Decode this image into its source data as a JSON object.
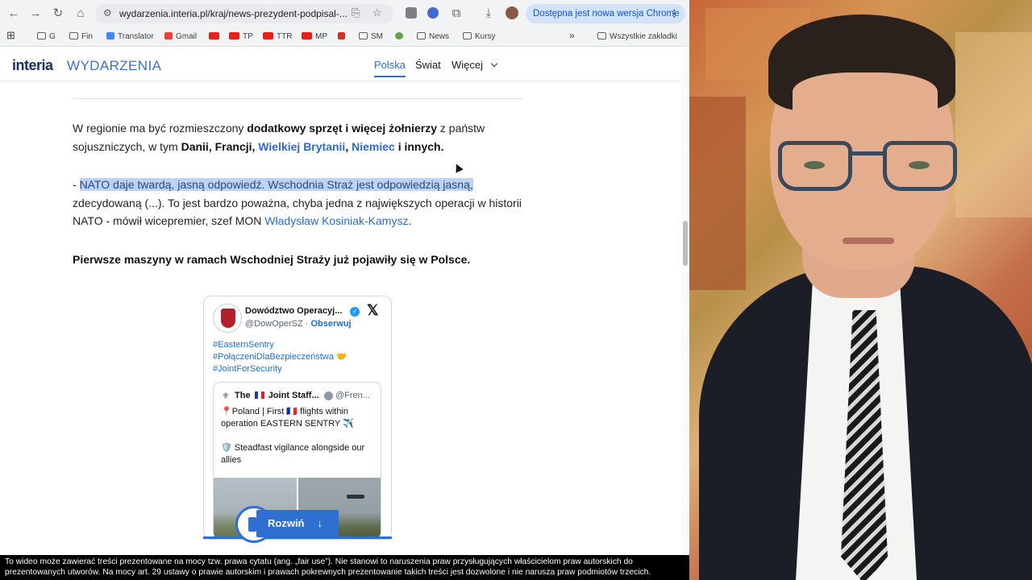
{
  "browser": {
    "url": "wydarzenia.interia.pl/kraj/news-prezydent-podpisal-...",
    "update_text": "Dostępna jest nowa wersja Chrome",
    "bookmarks": [
      "G",
      "Fin",
      "Translator",
      "Gmail",
      "TP",
      "TTR",
      "MP",
      "SM",
      "News",
      "Kursy"
    ],
    "overflow": "»",
    "all_bookmarks": "Wszystkie zakładki"
  },
  "site": {
    "logo_brand": "interia",
    "logo_section": "WYDARZENIA",
    "nav": [
      "Polska",
      "Świat",
      "Więcej"
    ]
  },
  "article": {
    "p1_a": "W regionie ma być rozmieszczony ",
    "p1_b": "dodatkowy sprzęt i więcej żołnierzy",
    "p1_c": " z państw sojuszniczych, w tym ",
    "p1_d": "Danii, Francji, ",
    "p1_link1": "Wielkiej Brytanii",
    "p1_comma": ", ",
    "p1_link2": "Niemiec",
    "p1_e": " i innych.",
    "p2_dash": "- ",
    "p2_highlight": "NATO daje twardą, jasną odpowiedź. Wschodnia Straż jest odpowiedzią jasną,",
    "p2_rest": " zdecydowaną (...). To jest bardzo poważna, chyba jedna z największych operacji w historii NATO - mówił wicepremier, szef MON ",
    "p2_link": "Władysław Kosiniak-Kamysz",
    "p2_end": ".",
    "p3": "Pierwsze maszyny w ramach Wschodniej Straży już pojawiły się w Polsce."
  },
  "tweet": {
    "name": "Dowództwo Operacyj...",
    "handle": "@DowOperSZ",
    "sep": " · ",
    "follow": "Obserwuj",
    "tag1": "#EasternSentry",
    "tag2": "#PołączeniDlaBezpieczeństwa 🤝",
    "tag3": "#JointForSecurity",
    "quote_name_a": "The",
    "quote_name_b": "Joint Staff...",
    "quote_handle": "@Fren...",
    "quote_line1": "📍Poland | First 🇫🇷 flights within operation EASTERN SENTRY ✈️",
    "quote_line2": "🛡️ Steadfast vigilance alongside our allies",
    "expand": "Rozwiń",
    "expand_arrow": "↓"
  },
  "disclaimer": {
    "line1": "To wideo może zawierać treści prezentowane na mocy tzw. prawa cytatu (ang. „fair use”). Nie stanowi to naruszenia praw przysługujących właścicielom praw autorskich do",
    "line2": "prezentowanych utworów. Na mocy art. 29 ustawy o prawie autorskim i prawach pokrewnych prezentowanie takich treści jest dozwolone i nie narusza praw podmiotów trzecich."
  },
  "colors": {
    "link": "#2b6bd1",
    "highlight": "#bcd3f5",
    "button": "#2f6fd1"
  }
}
